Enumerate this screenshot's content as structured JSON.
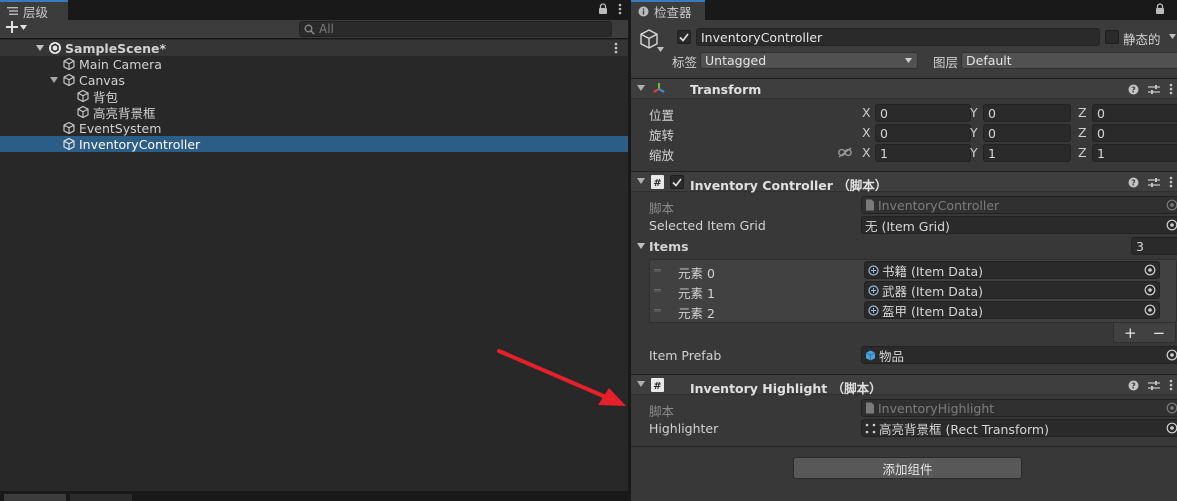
{
  "hierarchy": {
    "tab_label": "层级",
    "search_placeholder": "All",
    "scene_name": "SampleScene*",
    "items": [
      {
        "label": "Main Camera"
      },
      {
        "label": "Canvas"
      },
      {
        "label": "背包"
      },
      {
        "label": "高亮背景框"
      },
      {
        "label": "EventSystem"
      },
      {
        "label": "InventoryController"
      }
    ]
  },
  "inspector": {
    "tab_label": "检查器",
    "object_name": "InventoryController",
    "static_label": "静态的",
    "tag_label": "标签",
    "tag_value": "Untagged",
    "layer_label": "图层",
    "layer_value": "Default",
    "transform": {
      "title": "Transform",
      "position_label": "位置",
      "rotation_label": "旋转",
      "scale_label": "缩放",
      "axis_x": "X",
      "axis_y": "Y",
      "axis_z": "Z",
      "position": [
        "0",
        "0",
        "0"
      ],
      "rotation": [
        "0",
        "0",
        "0"
      ],
      "scale": [
        "1",
        "1",
        "1"
      ]
    },
    "inventory_controller": {
      "title": "Inventory Controller （脚本）",
      "script_label": "脚本",
      "script_value": "InventoryController",
      "selected_grid_label": "Selected Item Grid",
      "selected_grid_value": "无 (Item Grid)",
      "items_label": "Items",
      "items_count": "3",
      "elements": [
        {
          "label": "元素 0",
          "value": "书籍 (Item Data)"
        },
        {
          "label": "元素 1",
          "value": "武器 (Item Data)"
        },
        {
          "label": "元素 2",
          "value": "盔甲 (Item Data)"
        }
      ],
      "plus_label": "+",
      "minus_label": "−",
      "prefab_label": "Item Prefab",
      "prefab_value": "物品"
    },
    "inventory_highlight": {
      "title": "Inventory Highlight （脚本）",
      "script_label": "脚本",
      "script_value": "InventoryHighlight",
      "highlighter_label": "Highlighter",
      "highlighter_value": "高亮背景框 (Rect Transform)"
    },
    "add_component_label": "添加组件"
  },
  "colors": {
    "selection": "#2c5d87",
    "arrow": "#e5202a",
    "panel": "#383838",
    "hierarchy_bg": "#282828"
  }
}
